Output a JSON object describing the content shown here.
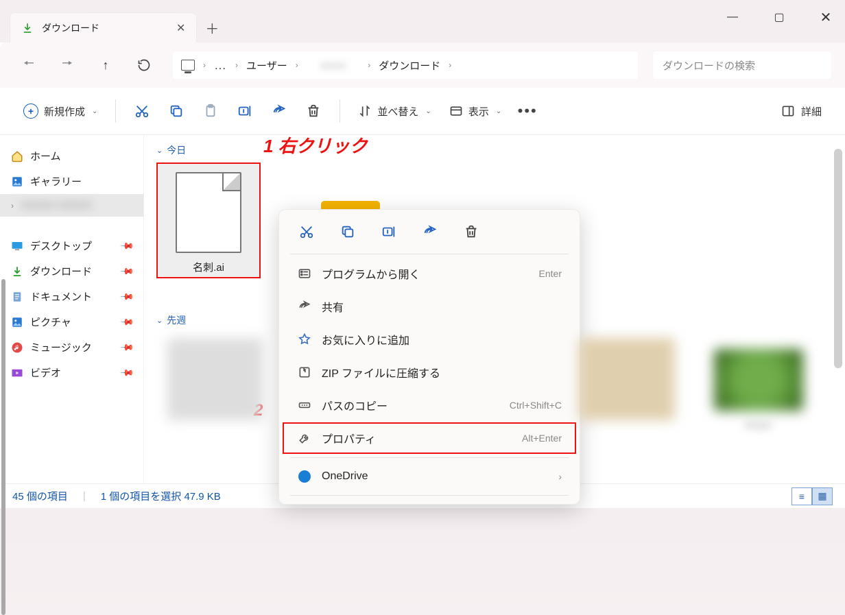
{
  "titlebar": {
    "tab_title": "ダウンロード"
  },
  "breadcrumb": {
    "item_users": "ユーザー",
    "item_hidden": "xxxxx",
    "item_downloads": "ダウンロード"
  },
  "search": {
    "placeholder": "ダウンロードの検索"
  },
  "toolbar": {
    "new_label": "新規作成",
    "sort_label": "並べ替え",
    "view_label": "表示",
    "details_label": "詳細"
  },
  "nav": {
    "home": "ホーム",
    "gallery": "ギャラリー",
    "hidden": "XXXXX XXXXX",
    "desktop": "デスクトップ",
    "downloads": "ダウンロード",
    "documents": "ドキュメント",
    "pictures": "ピクチャ",
    "music": "ミュージック",
    "videos": "ビデオ"
  },
  "groups": {
    "today": "今日",
    "lastweek": "先週"
  },
  "file": {
    "name": "名刺.ai"
  },
  "blurred_label": "ed.pur",
  "annotations": {
    "a1": "1 右クリック",
    "a2": "2"
  },
  "context_menu": {
    "open_with": "プログラムから開く",
    "open_with_shortcut": "Enter",
    "share": "共有",
    "favorite": "お気に入りに追加",
    "zip": "ZIP ファイルに圧縮する",
    "copy_path": "パスのコピー",
    "copy_path_shortcut": "Ctrl+Shift+C",
    "properties": "プロパティ",
    "properties_shortcut": "Alt+Enter",
    "onedrive": "OneDrive"
  },
  "status": {
    "items": "45 個の項目",
    "selected": "1 個の項目を選択 47.9 KB"
  }
}
